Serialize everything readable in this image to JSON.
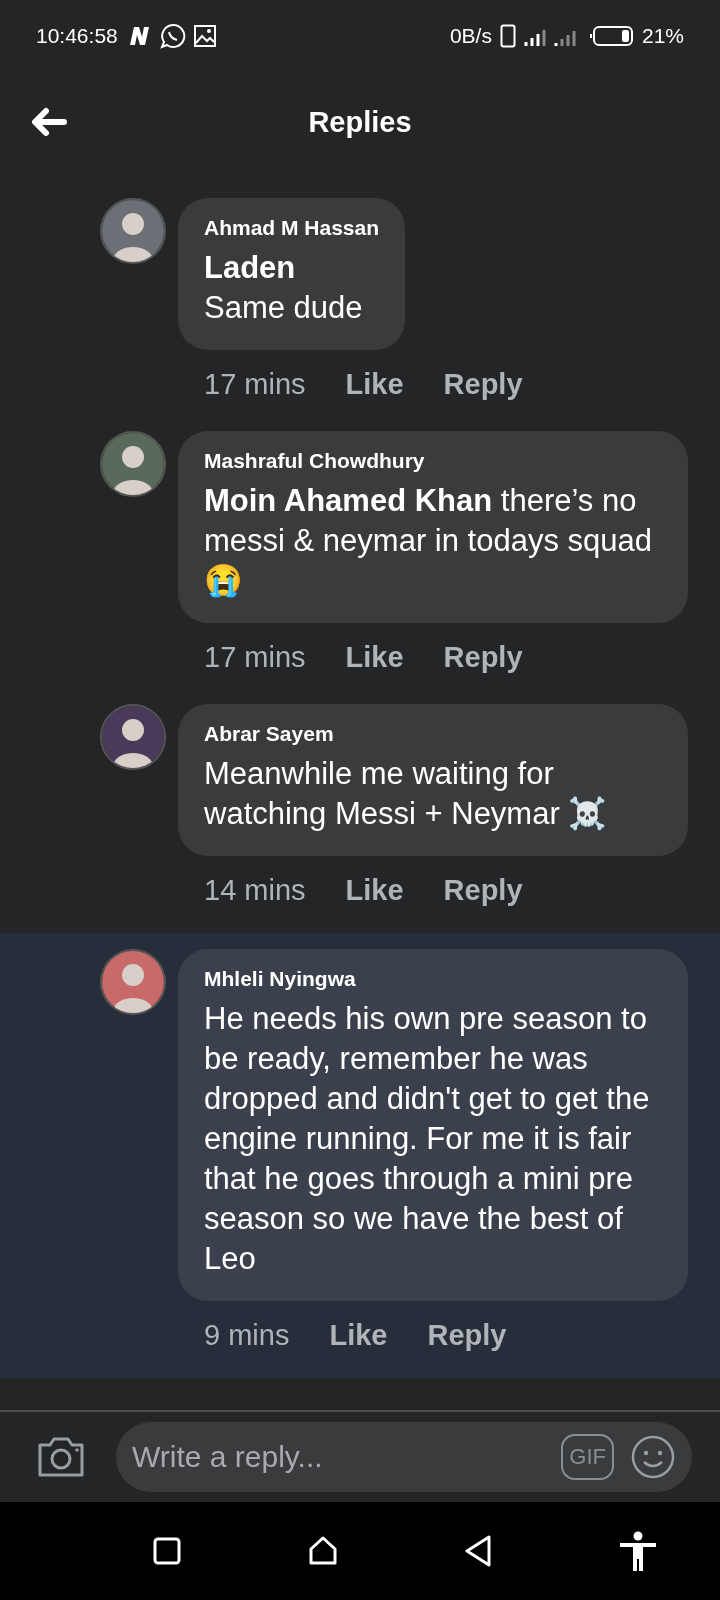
{
  "status_bar": {
    "time": "10:46:58",
    "speed": "0B/s",
    "battery": "21%"
  },
  "header": {
    "title": "Replies"
  },
  "comments": [
    {
      "author": "Ahmad M Hassan",
      "text": "**Laden**\nSame dude",
      "highlighted": false,
      "time": "17 mins",
      "like": "Like",
      "reply": "Reply"
    },
    {
      "author": "Mashraful Chowdhury",
      "text": "**Moin Ahamed Khan**  there’s no messi & neymar in todays squad 😭",
      "highlighted": false,
      "time": "17 mins",
      "like": "Like",
      "reply": "Reply"
    },
    {
      "author": "Abrar Sayem",
      "text": "Meanwhile me waiting for watching Messi + Neymar ☠️",
      "highlighted": false,
      "time": "14 mins",
      "like": "Like",
      "reply": "Reply"
    },
    {
      "author": "Mhleli Nyingwa",
      "text": "He needs his own pre season to be ready, remember he was dropped and didn't get to get the engine running. For me it is fair that he goes through a mini pre season so we have the best of Leo",
      "highlighted": true,
      "time": "9 mins",
      "like": "Like",
      "reply": "Reply"
    }
  ],
  "composer": {
    "placeholder": "Write a reply...",
    "gif": "GIF"
  }
}
